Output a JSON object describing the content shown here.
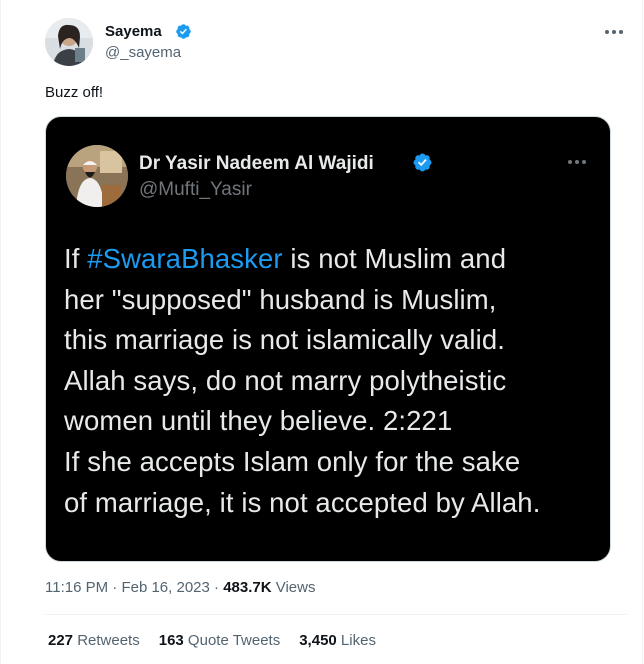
{
  "tweet": {
    "author": {
      "name": "Sayema",
      "handle": "@_sayema"
    },
    "text": "Buzz off!",
    "quoted": {
      "author": {
        "name": "Dr Yasir Nadeem Al Wajidi",
        "handle": "@Mufti_Yasir"
      },
      "text_lines": [
        {
          "before": "If ",
          "hashtag": "#SwaraBhasker",
          "after": " is not Muslim and"
        },
        {
          "text": "her \"supposed\" husband is Muslim,"
        },
        {
          "text": "this marriage is not islamically valid."
        },
        {
          "text": "Allah says, do not marry polytheistic"
        },
        {
          "text": "women until they believe. 2:221"
        },
        {
          "text": "If she accepts Islam only for the sake"
        },
        {
          "text": "of marriage, it is not accepted by Allah."
        }
      ]
    },
    "meta": {
      "time": "11:16 PM",
      "sep1": " · ",
      "date": "Feb 16, 2023",
      "sep2": " · ",
      "views_count": "483.7K",
      "views_label": " Views"
    },
    "stats": {
      "retweets": {
        "count": "227",
        "label": " Retweets"
      },
      "quotes": {
        "count": "163",
        "label": " Quote Tweets"
      },
      "likes": {
        "count": "3,450",
        "label": " Likes"
      }
    }
  },
  "colors": {
    "accent": "#1d9bf0",
    "verified": "#1d9bf0",
    "secondary_text": "#536471",
    "embed_background": "#000000"
  },
  "icons": {
    "verified": "verified-badge-icon",
    "more": "more-dots-icon"
  }
}
